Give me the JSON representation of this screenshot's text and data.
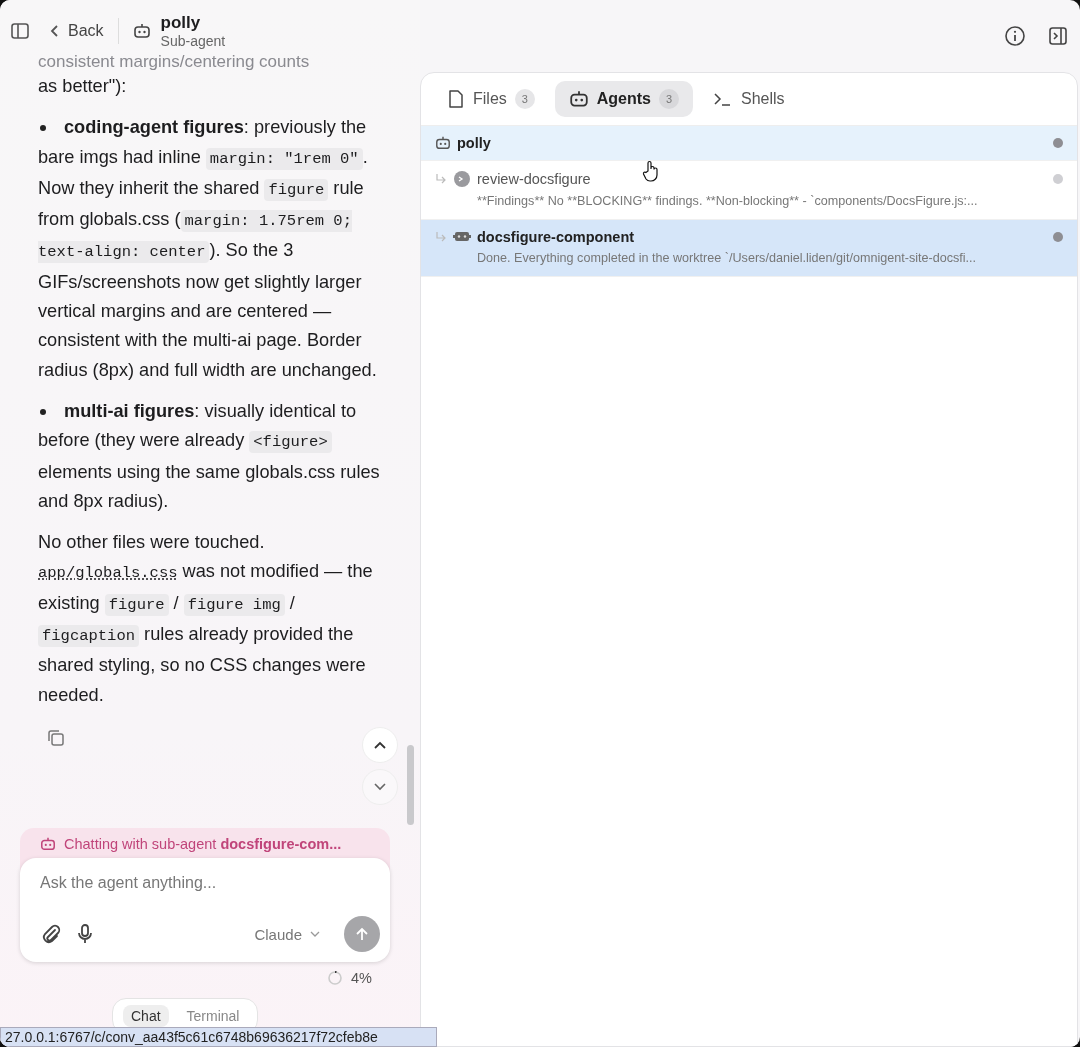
{
  "header": {
    "back": "Back",
    "title": "polly",
    "subtitle": "Sub-agent"
  },
  "message": {
    "faded_line": "consistent margins/centering counts",
    "blocks": [
      {
        "kind": "para",
        "segments": [
          {
            "kind": "text",
            "text": "as better\"):"
          }
        ]
      },
      {
        "kind": "bullet",
        "segments": [
          {
            "kind": "bold",
            "text": "coding-agent figures"
          },
          {
            "kind": "text",
            "text": ": previously the bare imgs had inline "
          },
          {
            "kind": "code",
            "text": "margin: \"1rem 0\""
          },
          {
            "kind": "text",
            "text": ". Now they inherit the shared "
          },
          {
            "kind": "code",
            "text": "figure"
          },
          {
            "kind": "text",
            "text": " rule from globals.css ("
          },
          {
            "kind": "code",
            "text": "margin: 1.75rem 0; text-align: center"
          },
          {
            "kind": "text",
            "text": "). So the 3 GIFs/screenshots now get slightly larger vertical margins and are centered — consistent with the multi-ai page. Border radius (8px) and full width are unchanged."
          }
        ]
      },
      {
        "kind": "bullet",
        "segments": [
          {
            "kind": "bold",
            "text": "multi-ai figures"
          },
          {
            "kind": "text",
            "text": ": visually identical to before (they were already "
          },
          {
            "kind": "code",
            "text": "<figure>"
          },
          {
            "kind": "text",
            "text": " elements using the same globals.css rules and 8px radius)."
          }
        ]
      },
      {
        "kind": "para",
        "segments": [
          {
            "kind": "text",
            "text": "No other files were touched. "
          },
          {
            "kind": "link",
            "text": "app/globals.css"
          },
          {
            "kind": "text",
            "text": " was not modified — the existing "
          },
          {
            "kind": "code",
            "text": "figure"
          },
          {
            "kind": "text",
            "text": " / "
          },
          {
            "kind": "code",
            "text": "figure img"
          },
          {
            "kind": "text",
            "text": " / "
          },
          {
            "kind": "code",
            "text": "figcaption"
          },
          {
            "kind": "text",
            "text": " rules already provided the shared styling, so no CSS changes were needed."
          }
        ]
      }
    ]
  },
  "chat_banner": {
    "prefix": "Chatting with sub-agent ",
    "agent": "docsfigure-com..."
  },
  "composer": {
    "placeholder": "Ask the agent anything...",
    "model": "Claude",
    "usage": "4%"
  },
  "bottom_tabs": [
    {
      "label": "Chat",
      "selected": true
    },
    {
      "label": "Terminal",
      "selected": false
    }
  ],
  "status_url": "27.0.0.1:6767/c/conv_aa43f5c61c6748b69636217f72cfeb8e",
  "tabs": [
    {
      "label": "Files",
      "count": "3",
      "kind": "files",
      "selected": false
    },
    {
      "label": "Agents",
      "count": "3",
      "kind": "agents",
      "selected": true
    },
    {
      "label": "Shells",
      "kind": "shells",
      "selected": false
    }
  ],
  "agents": [
    {
      "kind": "main",
      "name": "polly",
      "hovered": true,
      "selected": false,
      "color": "#8e8e93"
    },
    {
      "kind": "reviewer",
      "name": "review-docsfigure",
      "summary": "**Findings** No **BLOCKING** findings. **Non-blocking** - `components/DocsFigure.js:...",
      "hovered": false,
      "selected": false,
      "color": "#cfcfd3"
    },
    {
      "kind": "worker",
      "name": "docsfigure-component",
      "summary": "Done. Everything completed in the worktree `/Users/daniel.liden/git/omnigent-site-docsfi...",
      "hovered": false,
      "selected": true,
      "color": "#8e8e93"
    }
  ]
}
